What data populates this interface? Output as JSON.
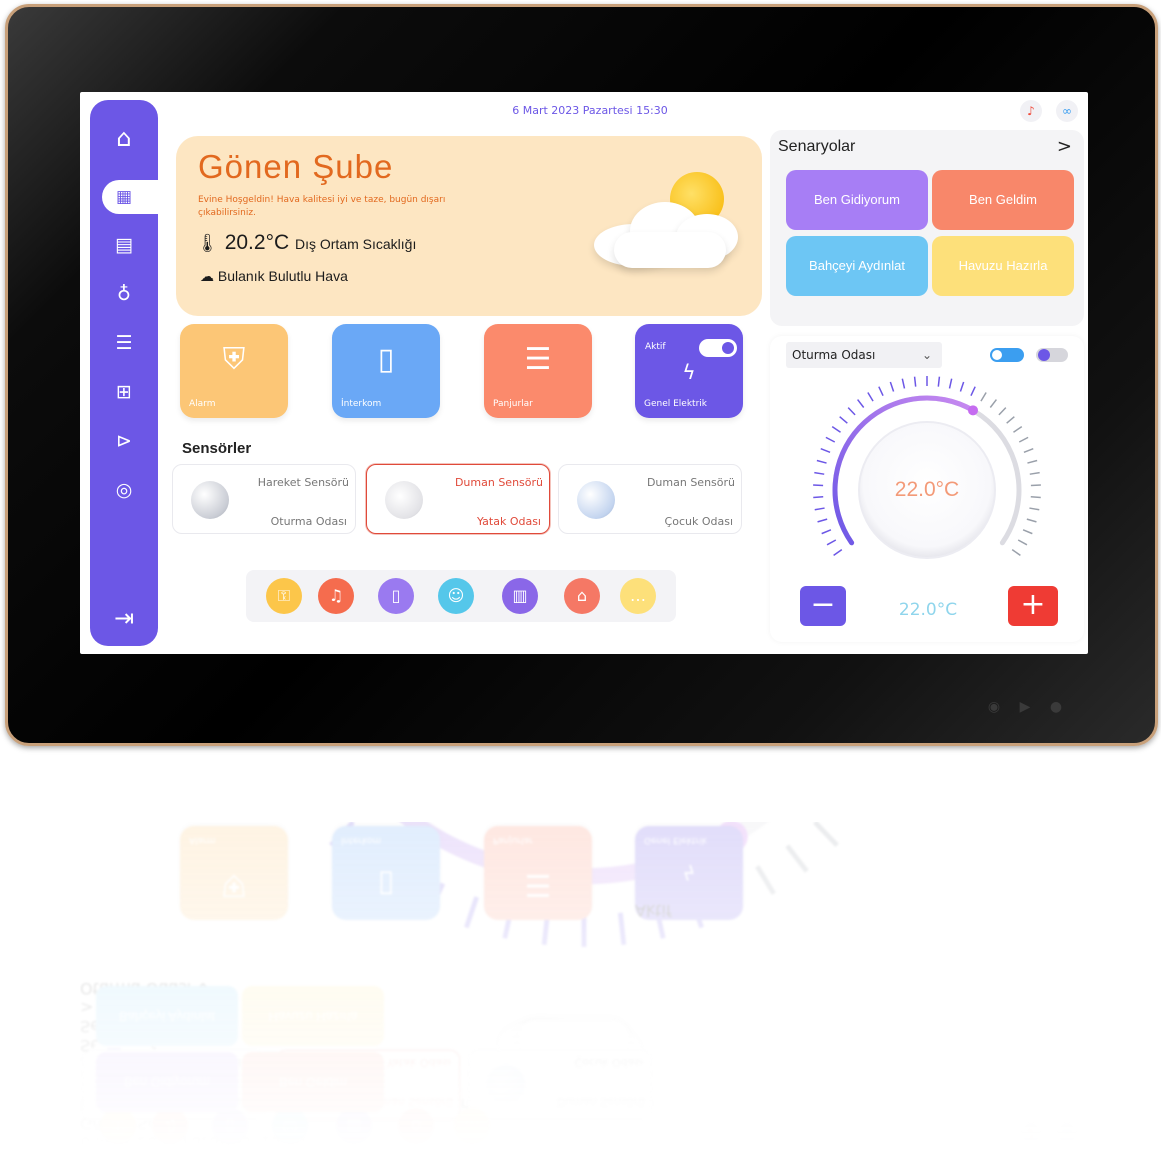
{
  "header": {
    "datetime": "6 Mart 2023 Pazartesi 15:30"
  },
  "sidebar": {
    "items": [
      {
        "icon": "home-logo-icon"
      },
      {
        "icon": "dashboard-icon",
        "active": true
      },
      {
        "icon": "building-icon"
      },
      {
        "icon": "lightbulb-icon"
      },
      {
        "icon": "blinds-icon"
      },
      {
        "icon": "network-icon"
      },
      {
        "icon": "camera-icon"
      },
      {
        "icon": "target-icon"
      },
      {
        "icon": "logout-icon"
      }
    ]
  },
  "weather": {
    "title": "Gönen Şube",
    "subtitle": "Evine Hoşgeldin! Hava kalitesi iyi ve taze, bugün dışarı çıkabilirsiniz.",
    "temperature": "20.2°C",
    "temperature_label": "Dış Ortam Sıcaklığı",
    "condition": "Bulanık Bulutlu Hava"
  },
  "tiles": [
    {
      "label": "Alarm",
      "color": "#fcc676",
      "icon": "shield-icon"
    },
    {
      "label": "İnterkom",
      "color": "#6aa8f6",
      "icon": "intercom-icon"
    },
    {
      "label": "Panjurlar",
      "color": "#fb8a6c",
      "icon": "blinds-icon"
    },
    {
      "label": "Genel Elektrik",
      "status": "Aktif",
      "color": "#6c57e6",
      "icon": "lightning-icon",
      "on": true
    }
  ],
  "sensors": {
    "title": "Sensörler",
    "items": [
      {
        "name": "Hareket Sensörü",
        "room": "Oturma Odası",
        "alarm": false
      },
      {
        "name": "Duman Sensörü",
        "room": "Yatak Odası",
        "alarm": true
      },
      {
        "name": "Duman Sensörü",
        "room": "Çocuk Odası",
        "alarm": false
      }
    ]
  },
  "bottom_nav": [
    {
      "icon": "key-icon",
      "color": "#fcc64a"
    },
    {
      "icon": "bell-icon",
      "color": "#f56c4e"
    },
    {
      "icon": "remote-icon",
      "color": "#9a7af0"
    },
    {
      "icon": "doorman-icon",
      "color": "#55c7ea"
    },
    {
      "icon": "wardrobe-icon",
      "color": "#8a67e8"
    },
    {
      "icon": "garage-icon",
      "color": "#f57865"
    },
    {
      "icon": "more-icon",
      "color": "#fde07a"
    }
  ],
  "scenarios": {
    "title": "Senaryolar",
    "more": ">",
    "items": [
      {
        "label": "Ben Gidiyorum",
        "color": "#a77ef5"
      },
      {
        "label": "Ben Geldim",
        "color": "#f8876a"
      },
      {
        "label": "Bahçeyi Aydınlat",
        "color": "#6dc6f4"
      },
      {
        "label": "Havuzu Hazırla",
        "color": "#fde07a"
      }
    ]
  },
  "thermostat": {
    "room": "Oturma Odası",
    "current": "22.0°C",
    "target": "22.0°C",
    "fan_on": true,
    "power_on": false,
    "level": 0.62
  }
}
